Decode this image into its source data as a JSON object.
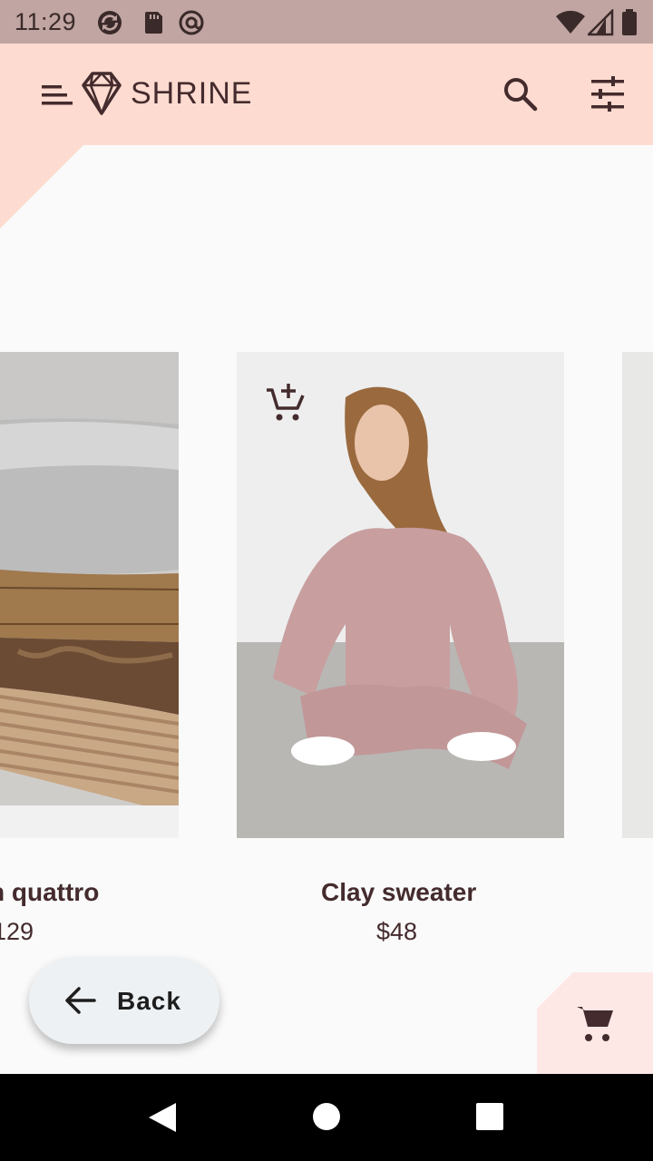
{
  "status_bar": {
    "time": "11:29",
    "icons": [
      "sync-icon",
      "sd-card-icon",
      "at-sign-icon",
      "wifi-icon",
      "signal-icon",
      "battery-icon"
    ]
  },
  "app_bar": {
    "title": "SHRINE",
    "icons": [
      "menu-icon",
      "diamond-logo-icon",
      "search-icon",
      "tune-icon"
    ]
  },
  "products": [
    {
      "title": "n quattro",
      "price": "129"
    },
    {
      "title": "Clay sweater",
      "price": "$48"
    }
  ],
  "back_button": {
    "label": "Back"
  },
  "colors": {
    "status_bar": "#c1a5a2",
    "app_bar": "#fedbd0",
    "text": "#442b2d",
    "background": "#fafafa",
    "cart_tab": "#fde8e6"
  },
  "nav_bar": {
    "icons": [
      "back-triangle-icon",
      "home-circle-icon",
      "recents-square-icon"
    ]
  }
}
